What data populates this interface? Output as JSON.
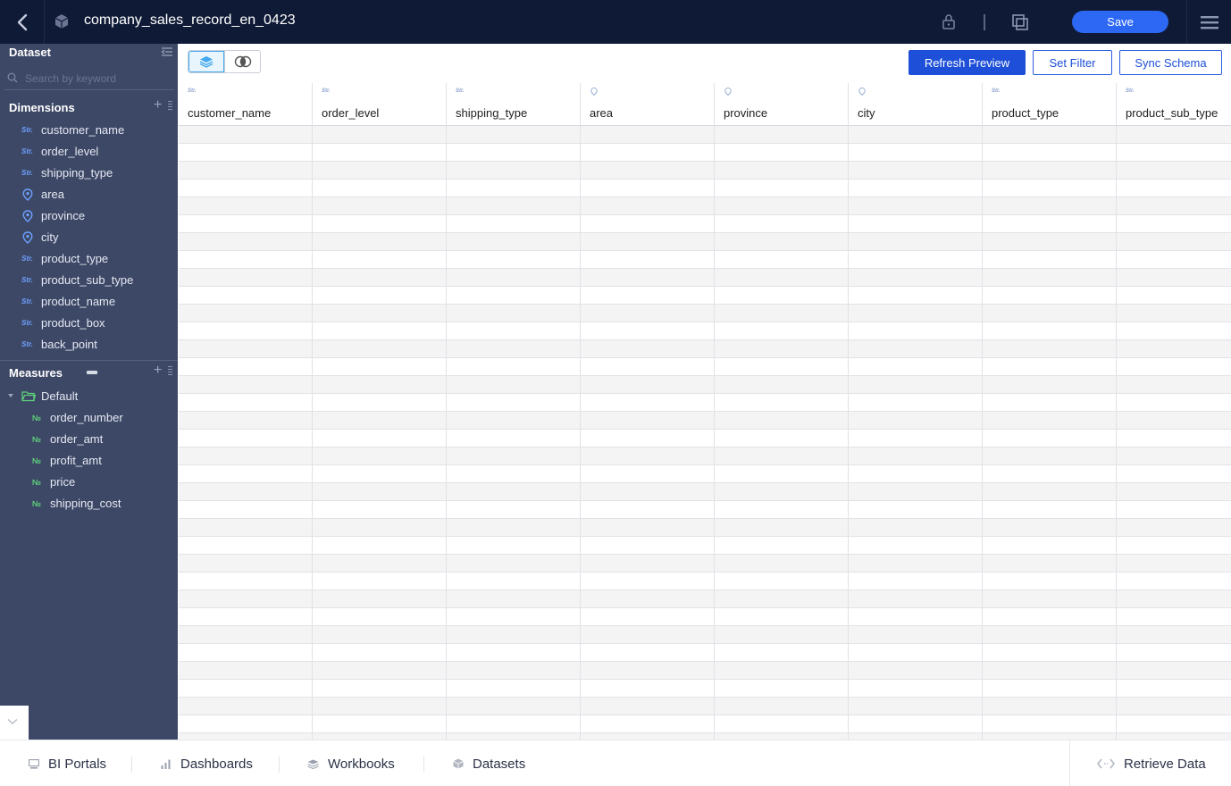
{
  "header": {
    "title": "company_sales_record_en_0423",
    "save_label": "Save"
  },
  "sidebar": {
    "title": "Dataset",
    "search_placeholder": "Search by keyword",
    "dimensions_title": "Dimensions",
    "dimensions": [
      {
        "type": "Str.",
        "label": "customer_name"
      },
      {
        "type": "Str.",
        "label": "order_level"
      },
      {
        "type": "Str.",
        "label": "shipping_type"
      },
      {
        "type": "geo",
        "label": "area"
      },
      {
        "type": "geo",
        "label": "province"
      },
      {
        "type": "geo",
        "label": "city"
      },
      {
        "type": "Str.",
        "label": "product_type"
      },
      {
        "type": "Str.",
        "label": "product_sub_type"
      },
      {
        "type": "Str.",
        "label": "product_name"
      },
      {
        "type": "Str.",
        "label": "product_box"
      },
      {
        "type": "Str.",
        "label": "back_point"
      }
    ],
    "measures_title": "Measures",
    "folder_label": "Default",
    "measure_type": "№",
    "measures": [
      {
        "label": "order_number"
      },
      {
        "label": "order_amt"
      },
      {
        "label": "profit_amt"
      },
      {
        "label": "price"
      },
      {
        "label": "shipping_cost"
      }
    ]
  },
  "toolbar": {
    "refresh_label": "Refresh Preview",
    "filter_label": "Set Filter",
    "sync_label": "Sync Schema"
  },
  "grid": {
    "type_str": "Str.",
    "columns": [
      {
        "type": "Str.",
        "name": "customer_name"
      },
      {
        "type": "Str.",
        "name": "order_level"
      },
      {
        "type": "Str.",
        "name": "shipping_type"
      },
      {
        "type": "geo",
        "name": "area"
      },
      {
        "type": "geo",
        "name": "province"
      },
      {
        "type": "geo",
        "name": "city"
      },
      {
        "type": "Str.",
        "name": "product_type"
      },
      {
        "type": "Str.",
        "name": "product_sub_type"
      }
    ]
  },
  "bottombar": {
    "bi_portals": "BI Portals",
    "dashboards": "Dashboards",
    "workbooks": "Workbooks",
    "datasets": "Datasets",
    "retrieve_data": "Retrieve Data"
  },
  "colors": {
    "header_bg": "#0f1a36",
    "sidebar_bg": "#3d4866",
    "primary": "#1d4fd8",
    "save": "#2d68f4",
    "str_icon": "#6ea0ff",
    "measure_icon": "#5fd07a"
  }
}
